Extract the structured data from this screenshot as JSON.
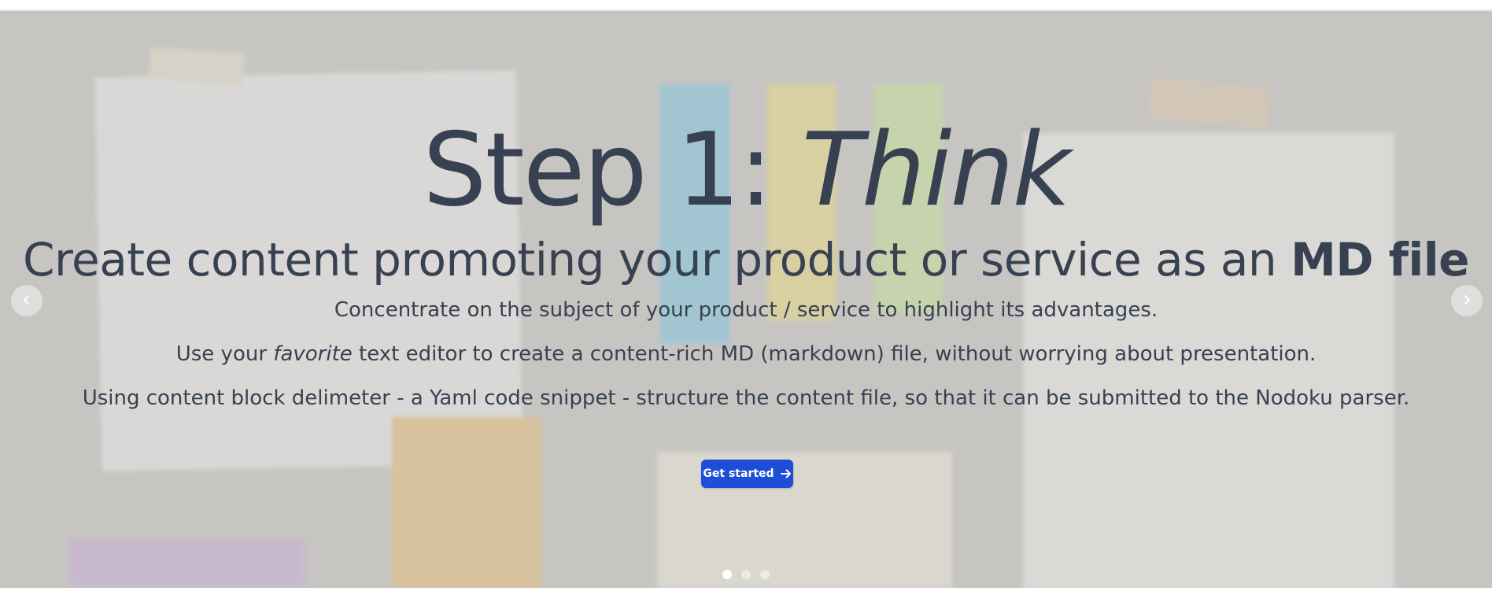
{
  "hero": {
    "title_prefix": "Step 1: ",
    "title_emphasis": "Think",
    "subtitle_prefix": "Create content promoting your product or service as an ",
    "subtitle_bold": "MD file",
    "paragraph1": "Concentrate on the subject of your product / service to highlight its advantages.",
    "paragraph2_prefix": "Use your ",
    "paragraph2_emphasis": "favorite",
    "paragraph2_suffix": " text editor to create a content-rich MD (markdown) file, without worrying about presentation.",
    "paragraph3": "Using content block delimeter - a Yaml code snippet - structure the content file, so that it can be submitted to the Nodoku parser.",
    "cta_label": "Get started"
  },
  "carousel": {
    "slide_count": 3,
    "active_slide": 1,
    "prev_icon": "chevron-left-icon",
    "next_icon": "chevron-right-icon"
  },
  "colors": {
    "text": "#374151",
    "button": "#1d4ed8",
    "background": "#c6c5c2"
  }
}
